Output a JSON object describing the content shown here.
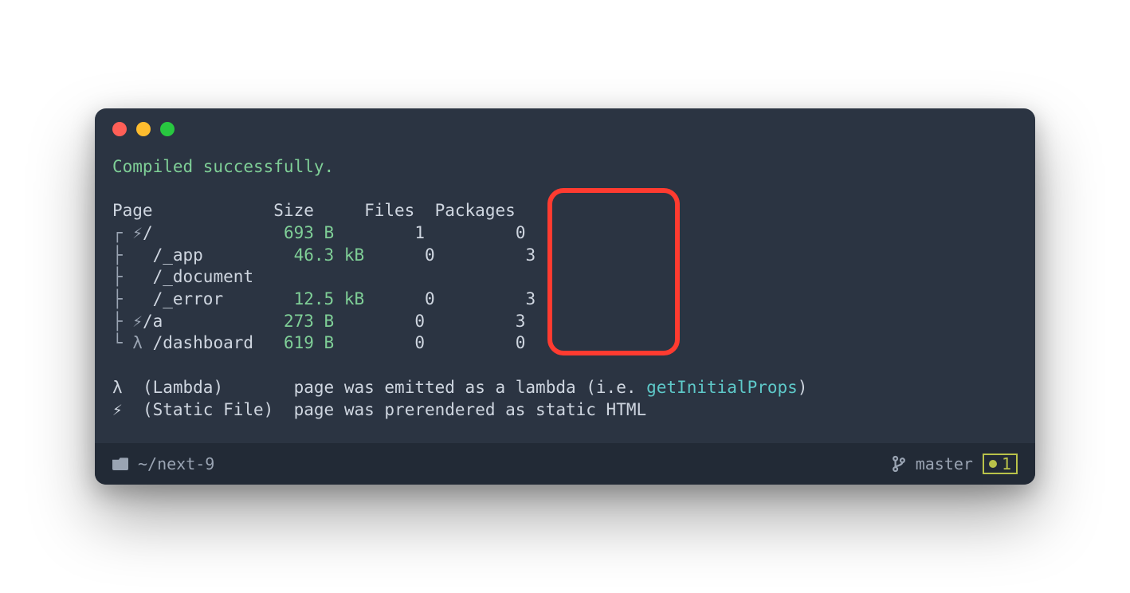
{
  "compile_status": "Compiled successfully.",
  "headers": {
    "page": "Page",
    "size": "Size",
    "files": "Files",
    "packages": "Packages"
  },
  "rows": [
    {
      "tree": "┌ ",
      "marker": "⚡",
      "path": "/",
      "size": "693 B",
      "files": "1",
      "packages": "0"
    },
    {
      "tree": "├ ",
      "marker": " ",
      "path": " /_app",
      "size": "46.3 kB",
      "files": "0",
      "packages": "3"
    },
    {
      "tree": "├ ",
      "marker": " ",
      "path": " /_document",
      "size": "",
      "files": "",
      "packages": ""
    },
    {
      "tree": "├ ",
      "marker": " ",
      "path": " /_error",
      "size": "12.5 kB",
      "files": "0",
      "packages": "3"
    },
    {
      "tree": "├ ",
      "marker": "⚡",
      "path": "/a",
      "size": "273 B",
      "files": "0",
      "packages": "3"
    },
    {
      "tree": "└ ",
      "marker": "λ",
      "path": " /dashboard",
      "size": "619 B",
      "files": "0",
      "packages": "0"
    }
  ],
  "legend": {
    "lambda_sym": "λ",
    "lambda_name": "(Lambda)",
    "lambda_desc_pre": "page was emitted as a lambda (i.e. ",
    "lambda_fn": "getInitialProps",
    "lambda_desc_post": ")",
    "static_sym": "⚡",
    "static_name": "(Static File)",
    "static_desc": "page was prerendered as static HTML"
  },
  "status": {
    "cwd": "~/next-9",
    "branch": "master",
    "sync_count": "1"
  }
}
